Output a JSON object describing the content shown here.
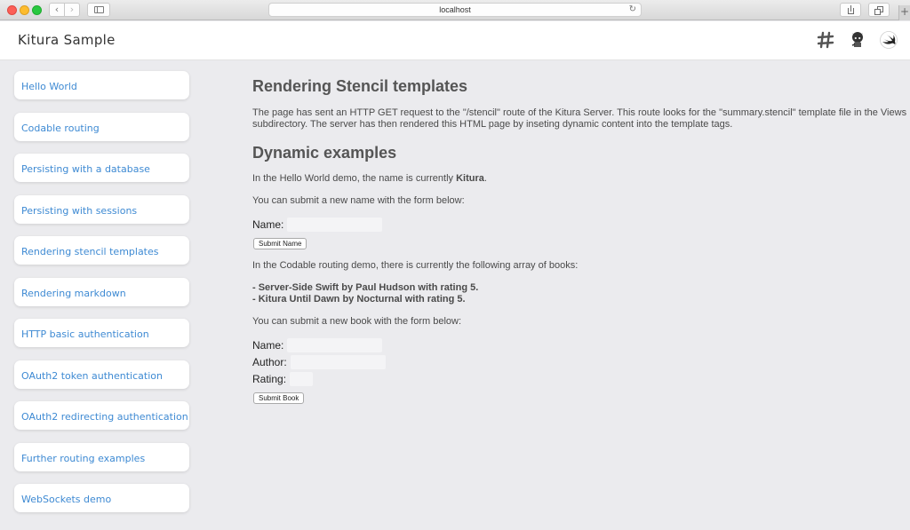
{
  "browser": {
    "url": "localhost",
    "nav_back": "‹",
    "nav_forward": "›",
    "reload_glyph": "↻",
    "new_tab_glyph": "+"
  },
  "app": {
    "title": "Kitura Sample",
    "header_icons": [
      "slack-icon",
      "github-icon",
      "swift-icon"
    ]
  },
  "sidebar": {
    "items": [
      {
        "label": "Hello World"
      },
      {
        "label": "Codable routing"
      },
      {
        "label": "Persisting with a database"
      },
      {
        "label": "Persisting with sessions"
      },
      {
        "label": "Rendering stencil templates"
      },
      {
        "label": "Rendering markdown"
      },
      {
        "label": "HTTP basic authentication"
      },
      {
        "label": "OAuth2 token authentication"
      },
      {
        "label": "OAuth2 redirecting authentication"
      },
      {
        "label": "Further routing examples"
      },
      {
        "label": "WebSockets demo"
      }
    ]
  },
  "main": {
    "heading": "Rendering Stencil templates",
    "intro": "The page has sent an HTTP GET request to the \"/stencil\" route of the Kitura Server. This route looks for the \"summary.stencil\" template file in the Views subdirectory. The server has then rendered this HTML page by inseting dynamic content into the template tags.",
    "dynamic_heading": "Dynamic examples",
    "hello_text": "In the Hello World demo, the name is currently ",
    "hello_name": "Kitura",
    "hello_suffix": ".",
    "submit_name_text": "You can submit a new name with the form below:",
    "name_label": "Name:",
    "name_value": "",
    "submit_name_button": "Submit Name",
    "codable_text": "In the Codable routing demo, there is currently the following array of books:",
    "books": [
      "- Server-Side Swift by Paul Hudson with rating 5.",
      "- Kitura Until Dawn by Nocturnal with rating 5."
    ],
    "submit_book_text": "You can submit a new book with the form below:",
    "book_form": {
      "name_label": "Name:",
      "author_label": "Author:",
      "rating_label": "Rating:",
      "name_value": "",
      "author_value": "",
      "rating_value": "",
      "submit_button": "Submit Book"
    }
  },
  "colors": {
    "link": "#3e8ad3",
    "background": "#ebebee"
  }
}
